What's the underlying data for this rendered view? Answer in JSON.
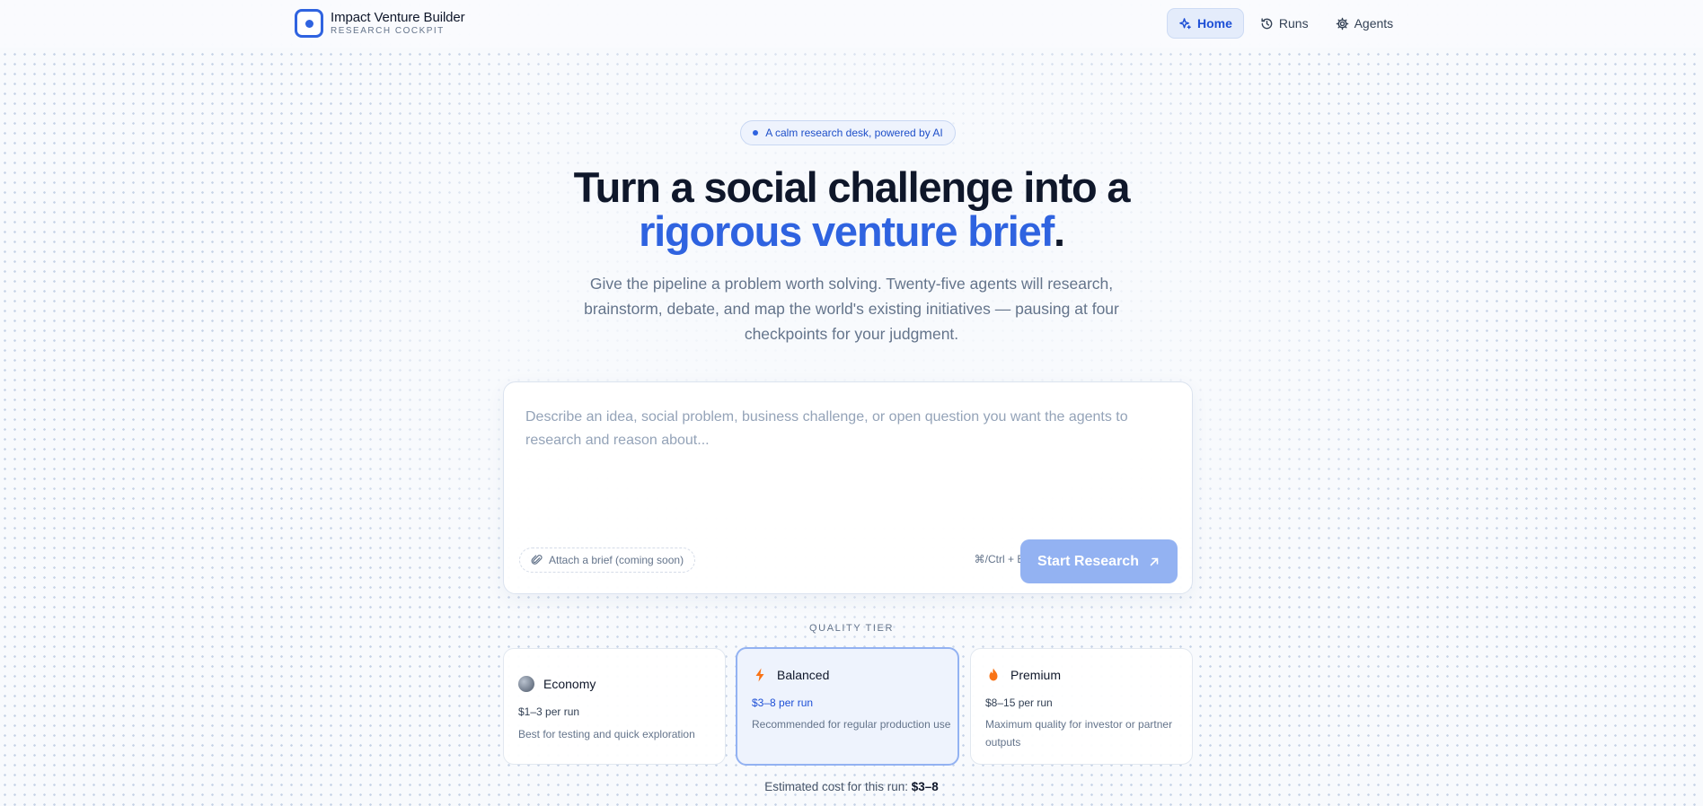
{
  "brand": {
    "title": "Impact Venture Builder",
    "subtitle": "RESEARCH COCKPIT"
  },
  "nav": [
    {
      "label": "Home",
      "icon": "sparkle-icon",
      "active": true
    },
    {
      "label": "Runs",
      "icon": "history-icon",
      "active": false
    },
    {
      "label": "Agents",
      "icon": "gear-icon",
      "active": false
    }
  ],
  "hero": {
    "pill": "A calm research desk, powered by AI",
    "headline_1": "Turn a social challenge into a",
    "headline_accent": "rigorous venture brief",
    "headline_end": ".",
    "lede": "Give the pipeline a problem worth solving. Twenty-five agents will research, brainstorm, debate, and map the world's existing initiatives — pausing at four checkpoints for your judgment."
  },
  "composer": {
    "value": "",
    "placeholder": "Describe an idea, social problem, business challenge, or open question you want the agents to research and reason about...",
    "attach_label": "Attach a brief (coming soon)",
    "shortcut": "⌘/Ctrl + Enter",
    "start_label": "Start Research"
  },
  "quality": {
    "label": "QUALITY TIER",
    "tiers": [
      {
        "name": "Economy",
        "price": "$1–3 per run",
        "desc": "Best for testing and quick exploration",
        "selected": false
      },
      {
        "name": "Balanced",
        "price": "$3–8 per run",
        "desc": "Recommended for regular production use",
        "selected": true
      },
      {
        "name": "Premium",
        "price": "$8–15 per run",
        "desc": "Maximum quality for investor or partner outputs",
        "selected": false
      }
    ],
    "estimate_prefix": "Estimated cost for this run:",
    "estimate_value": "$3–8"
  },
  "colors": {
    "accent": "#2f63e0",
    "button_disabled": "#93b2f2",
    "text": "#0f172a",
    "muted": "#64748b"
  }
}
